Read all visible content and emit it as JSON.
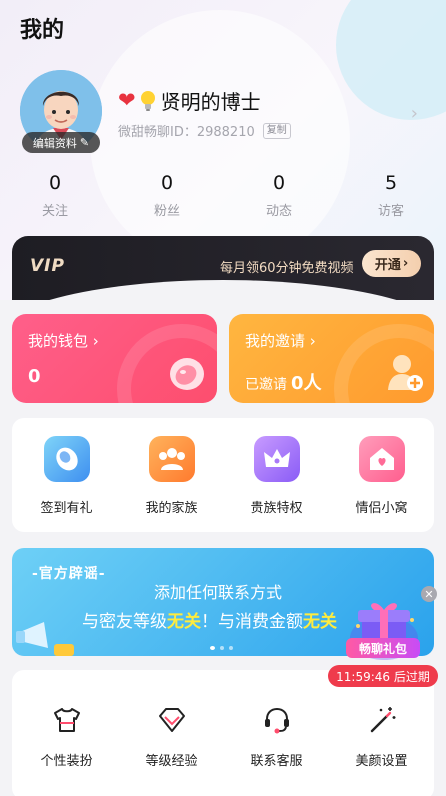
{
  "header": {
    "title": "我的"
  },
  "profile": {
    "edit_label": "编辑资料",
    "nickname": "贤明的博士",
    "id_text": "微甜畅聊ID：2988210",
    "copy_label": "复制"
  },
  "stats": [
    {
      "value": "0",
      "label": "关注"
    },
    {
      "value": "0",
      "label": "粉丝"
    },
    {
      "value": "0",
      "label": "动态"
    },
    {
      "value": "5",
      "label": "访客"
    }
  ],
  "vip": {
    "logo": "VIP",
    "text": "每月领60分钟免费视频",
    "button": "开通"
  },
  "wallet": {
    "title": "我的钱包",
    "value": "0"
  },
  "invite": {
    "title": "我的邀请",
    "prefix": "已邀请",
    "count": "0人"
  },
  "grid": [
    {
      "label": "签到有礼",
      "icon": "bean-icon"
    },
    {
      "label": "我的家族",
      "icon": "family-icon"
    },
    {
      "label": "贵族特权",
      "icon": "crown-icon"
    },
    {
      "label": "情侣小窝",
      "icon": "home-icon"
    }
  ],
  "banner": {
    "tag": "-官方辟谣-",
    "line1": "添加任何联系方式",
    "line2_a": "与密友等级",
    "line2_b": "无关",
    "line2_c": "！与消费金额",
    "line2_d": "无关"
  },
  "gift": {
    "label": "畅聊礼包",
    "countdown": "11:59:46 后过期"
  },
  "tools": [
    {
      "label": "个性装扮",
      "icon": "tshirt-icon"
    },
    {
      "label": "等级经验",
      "icon": "gem-icon"
    },
    {
      "label": "联系客服",
      "icon": "headset-icon"
    },
    {
      "label": "美颜设置",
      "icon": "magic-wand-icon"
    }
  ],
  "colors": {
    "wallet": "#fd4e6e",
    "invite": "#ff9a2e",
    "banner": "#2aa2ec",
    "countdown": "#ef3b4c"
  }
}
